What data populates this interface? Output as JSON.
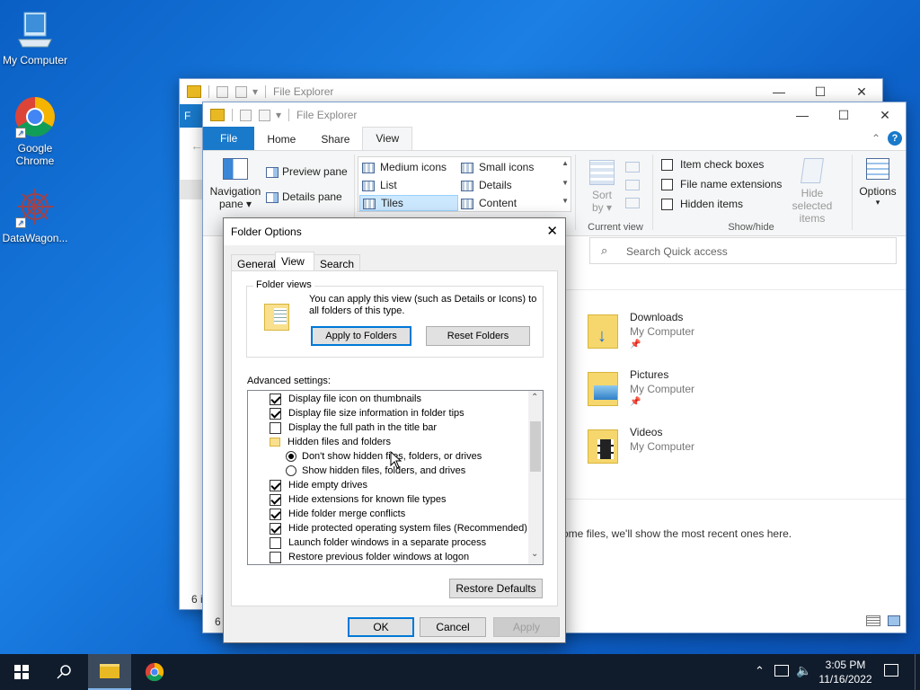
{
  "desktop": {
    "icons": [
      {
        "label": "My Computer"
      },
      {
        "label": "Google Chrome"
      },
      {
        "label": "DataWagon..."
      }
    ]
  },
  "back_window": {
    "title": "File Explorer",
    "tab_partial": "F",
    "status_partial": "6 i"
  },
  "explorer": {
    "title": "File Explorer",
    "tabs": [
      "File",
      "Home",
      "Share",
      "View"
    ],
    "ribbon": {
      "nav_pane": "Navigation",
      "nav_pane2": "pane",
      "preview_pane": "Preview pane",
      "details_pane": "Details pane",
      "layouts": [
        "Medium icons",
        "Small icons",
        "List",
        "Details",
        "Tiles",
        "Content"
      ],
      "sort": "Sort",
      "sort2": "by",
      "current_view": "Current view",
      "item_checkboxes": "Item check boxes",
      "file_name_ext": "File name extensions",
      "hidden_items": "Hidden items",
      "hide_selected": "Hide selected",
      "hide_selected2": "items",
      "show_hide": "Show/hide",
      "options": "Options"
    },
    "search_placeholder": "Search Quick access",
    "quick_access": [
      {
        "name": "Downloads",
        "location": "My Computer"
      },
      {
        "name": "Pictures",
        "location": "My Computer"
      },
      {
        "name": "Videos",
        "location": "My Computer"
      }
    ],
    "recent_msg": "ome files, we'll show the most recent ones here.",
    "status_partial": "6"
  },
  "dialog": {
    "title": "Folder Options",
    "tabs": [
      "General",
      "View",
      "Search"
    ],
    "folder_views_label": "Folder views",
    "folder_views_text": "You can apply this view (such as Details or Icons) to all folders of this type.",
    "apply_btn": "Apply to Folders",
    "reset_btn": "Reset Folders",
    "advanced_label": "Advanced settings:",
    "advanced": [
      {
        "label": "Display file icon on thumbnails",
        "type": "check",
        "checked": true
      },
      {
        "label": "Display file size information in folder tips",
        "type": "check",
        "checked": true
      },
      {
        "label": "Display the full path in the title bar",
        "type": "check",
        "checked": false
      },
      {
        "label": "Hidden files and folders",
        "type": "folder"
      },
      {
        "label": "Don't show hidden files, folders, or drives",
        "type": "radio",
        "checked": true
      },
      {
        "label": "Show hidden files, folders, and drives",
        "type": "radio",
        "checked": false
      },
      {
        "label": "Hide empty drives",
        "type": "check",
        "checked": true
      },
      {
        "label": "Hide extensions for known file types",
        "type": "check",
        "checked": true
      },
      {
        "label": "Hide folder merge conflicts",
        "type": "check",
        "checked": true
      },
      {
        "label": "Hide protected operating system files (Recommended)",
        "type": "check",
        "checked": true
      },
      {
        "label": "Launch folder windows in a separate process",
        "type": "check",
        "checked": false
      },
      {
        "label": "Restore previous folder windows at logon",
        "type": "check",
        "checked": false
      }
    ],
    "restore_defaults": "Restore Defaults",
    "ok": "OK",
    "cancel": "Cancel",
    "apply": "Apply"
  },
  "taskbar": {
    "time": "3:05 PM",
    "date": "11/16/2022"
  }
}
